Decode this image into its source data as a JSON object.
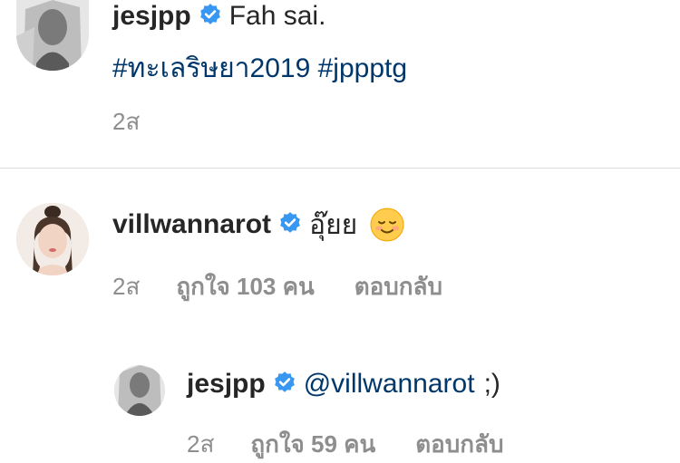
{
  "caption": {
    "username": "jesjpp",
    "text": "Fah sai.",
    "hashtags": "#ทะเลริษยา2019 #jppptg",
    "time": "2ส"
  },
  "comment": {
    "username": "villwannarot",
    "text": "อุ๊ยย",
    "emoji": "smiling-face-emoji",
    "time": "2ส",
    "likes": "ถูกใจ 103 คน",
    "reply": "ตอบกลับ"
  },
  "reply": {
    "username": "jesjpp",
    "mention": "@villwannarot",
    "text": ";)",
    "time": "2ส",
    "likes": "ถูกใจ 59 คน",
    "reply": "ตอบกลับ"
  },
  "colors": {
    "verified": "#3897f0",
    "link": "#00376b",
    "meta": "#8e8e8e"
  }
}
